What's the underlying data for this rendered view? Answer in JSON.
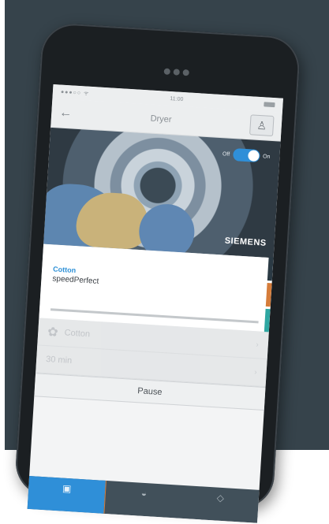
{
  "status_bar": {
    "signal": "●●●○○ ᯤ",
    "time": "11:00"
  },
  "header": {
    "back_label": "←",
    "title": "Dryer",
    "user_icon": "user-icon"
  },
  "hero": {
    "toggle_off_label": "Off",
    "toggle_on_label": "On",
    "toggle_state": "on",
    "brand": "SIEMENS"
  },
  "program": {
    "name": "Cotton",
    "option": "speedPerfect"
  },
  "settings": [
    {
      "label": "Cotton",
      "icon": "cotton-icon",
      "chevron": "›"
    },
    {
      "label": "30 min",
      "icon": "",
      "chevron": "›"
    }
  ],
  "actions": {
    "pause_label": "Pause"
  },
  "bottom_nav": [
    {
      "label": "",
      "icon": "appliance-icon",
      "active": true
    },
    {
      "label": "",
      "icon": "recipes-icon",
      "active": false
    },
    {
      "label": "",
      "icon": "settings-icon",
      "active": false
    }
  ],
  "colors": {
    "accent": "#2f8fd8",
    "background": "#36434b",
    "nav": "#41505a"
  }
}
